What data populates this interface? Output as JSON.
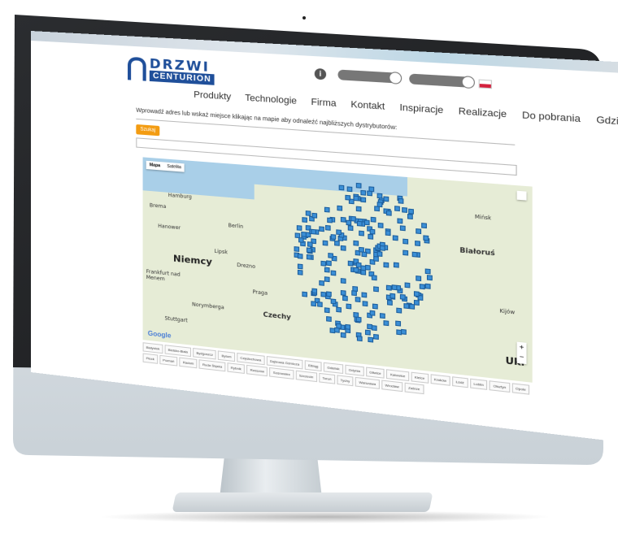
{
  "logo": {
    "top": "DRZWI",
    "bottom": "CENTURION"
  },
  "header": {
    "info_symbol": "i",
    "pill1": "",
    "pill2": ""
  },
  "nav": {
    "items": [
      "Produkty",
      "Technologie",
      "Firma",
      "Kontakt",
      "Inspiracje",
      "Realizacje",
      "Do pobrania",
      "Gdzie Kupić"
    ]
  },
  "search": {
    "label": "Wprowadź adres lub wskaż miejsce klikając na mapie aby odnaleźć najbliższych dystrybutorów:",
    "button": "Szukaj"
  },
  "map": {
    "tabs": [
      "Mapa",
      "Satelita"
    ],
    "labels": {
      "hamburg": "Hamburg",
      "berlin": "Berlin",
      "niemcy": "Niemcy",
      "czechy": "Czechy",
      "praga": "Praga",
      "bialorus": "Białoruś",
      "minsk": "Mińsk",
      "frankfurt": "Frankfurt nad Menem",
      "norymberga": "Norymberga",
      "stuttgart": "Stuttgart",
      "lipsk": "Lipsk",
      "drezno": "Drezno",
      "ukraine": "Ukr",
      "bremen": "Brema",
      "hanover": "Hanower",
      "kijow": "Kijów"
    },
    "google": "Google",
    "zoom_in": "+",
    "zoom_out": "−"
  },
  "cities": [
    "Białystok",
    "Bielsko-Biała",
    "Bydgoszcz",
    "Bytom",
    "Częstochowa",
    "Dąbrowa Górnicza",
    "Elbląg",
    "Gdańsk",
    "Gdynia",
    "Gliwice",
    "Katowice",
    "Kielce",
    "Kraków",
    "Łódź",
    "Lublin",
    "Olsztyn",
    "Opole",
    "Płock",
    "Poznań",
    "Radom",
    "Ruda Śląska",
    "Rybnik",
    "Rzeszów",
    "Sosnowiec",
    "Szczecin",
    "Toruń",
    "Tychy",
    "Warszawa",
    "Wrocław",
    "Zabrze"
  ]
}
